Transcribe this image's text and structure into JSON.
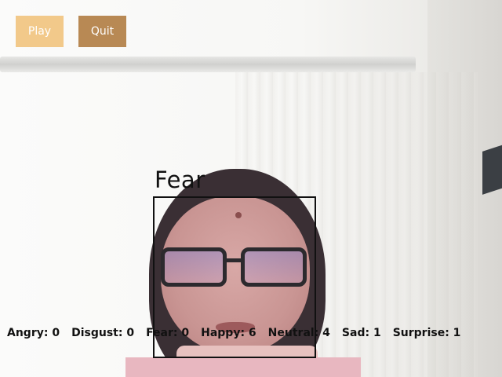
{
  "controls": {
    "play_label": "Play",
    "quit_label": "Quit"
  },
  "detection": {
    "emotion": "Fear"
  },
  "counts": [
    {
      "label": "Angry",
      "value": 0,
      "text": "Angry: 0"
    },
    {
      "label": "Disgust",
      "value": 0,
      "text": "Disgust: 0"
    },
    {
      "label": "Fear",
      "value": 0,
      "text": "Fear: 0"
    },
    {
      "label": "Happy",
      "value": 6,
      "text": "Happy: 6"
    },
    {
      "label": "Neutral",
      "value": 4,
      "text": "Neutral: 4"
    },
    {
      "label": "Sad",
      "value": 1,
      "text": "Sad: 1"
    },
    {
      "label": "Surprise",
      "value": 1,
      "text": "Surprise: 1"
    }
  ],
  "colors": {
    "play_button": "#f2c98a",
    "quit_button": "#b88954",
    "overlay_text": "#111111"
  }
}
